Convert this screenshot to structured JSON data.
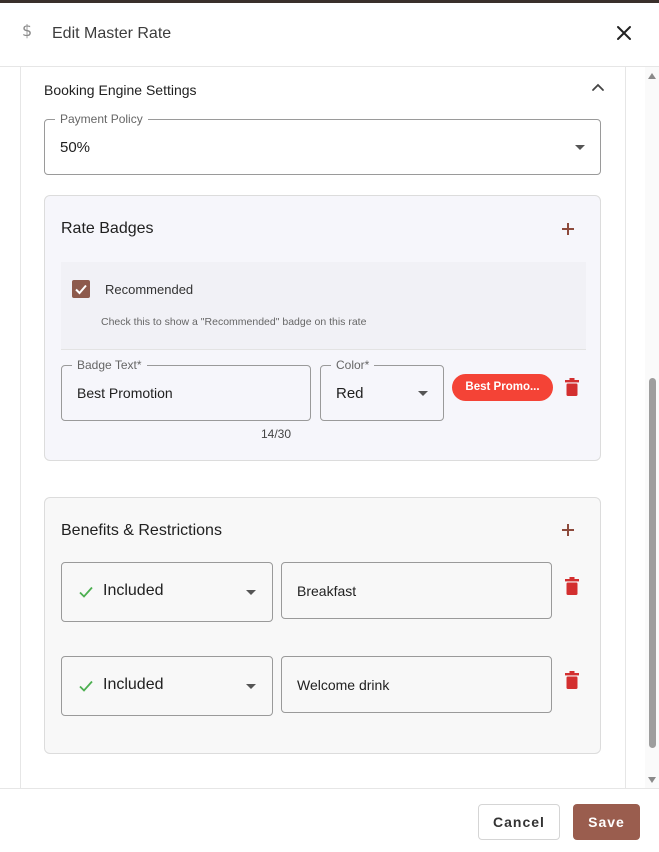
{
  "dialog": {
    "title": "Edit Master Rate",
    "title_icon": "dollar-icon",
    "close_icon": "close-icon"
  },
  "booking_engine": {
    "section_title": "Booking Engine Settings",
    "collapse_icon": "chevron-up-icon",
    "payment_policy": {
      "label": "Payment Policy",
      "value": "50%"
    }
  },
  "rate_badges": {
    "title": "Rate Badges",
    "add_icon": "plus-icon",
    "recommended": {
      "label": "Recommended",
      "checked": true,
      "helper": "Check this to show a \"Recommended\" badge on this rate"
    },
    "badge_text": {
      "label": "Badge Text*",
      "value": "Best Promotion",
      "counter": "14/30"
    },
    "color": {
      "label": "Color*",
      "value": "Red"
    },
    "preview_label": "Best Promo...",
    "preview_color": "#f44336",
    "delete_icon": "trash-icon"
  },
  "benefits": {
    "title": "Benefits & Restrictions",
    "add_icon": "plus-icon",
    "items": [
      {
        "status": "Included",
        "status_icon": "check-icon",
        "text": "Breakfast"
      },
      {
        "status": "Included",
        "status_icon": "check-icon",
        "text": "Welcome drink"
      }
    ]
  },
  "footer": {
    "cancel_label": "Cancel",
    "save_label": "Save"
  },
  "colors": {
    "accent": "#9a5d4e",
    "danger": "#d32f2f",
    "success": "#4caf50",
    "badge_card_bg": "#f6f6fb",
    "benefits_card_bg": "#f8f8f8"
  }
}
